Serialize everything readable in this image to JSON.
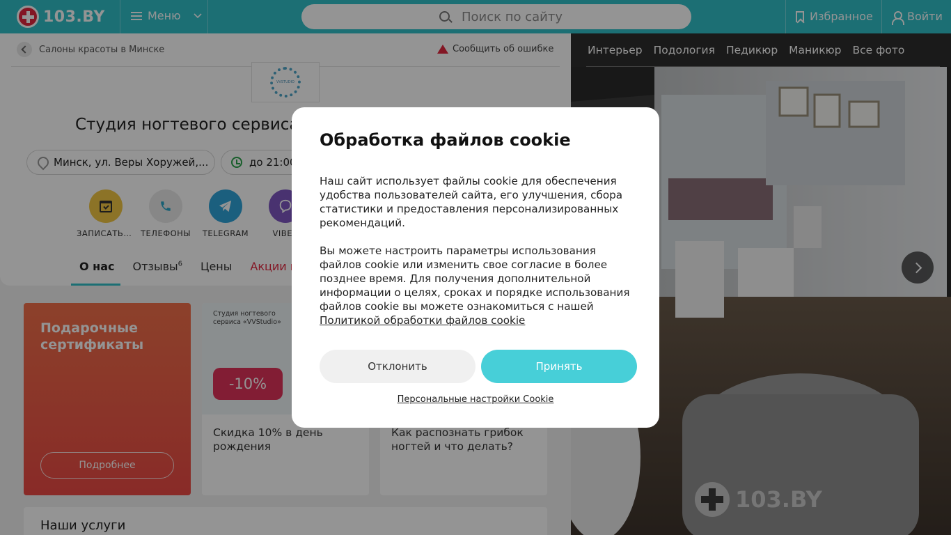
{
  "header": {
    "logo_text": "103.BY",
    "menu_label": "Меню",
    "search_placeholder": "Поиск по сайту",
    "favorites_label": "Избранное",
    "login_label": "Войти",
    "brand_color": "#31c0c9"
  },
  "breadcrumb": {
    "label": "Салоны красоты в Минске"
  },
  "report_error_label": "Сообщить об ошибке",
  "salon": {
    "logo_text": "VVSTUDIO",
    "title": "Студия ногтевого сервиса «VVStudio»",
    "address": "Минск, ул. Веры Хоружей,...",
    "hours": "до 21:00"
  },
  "actions": [
    {
      "label": "ЗАПИСАТЬСЯ",
      "icon": "calendar-icon",
      "color": "#f2c644"
    },
    {
      "label": "ТЕЛЕФОНЫ",
      "icon": "phone-icon",
      "color": "#e8e8e8"
    },
    {
      "label": "TELEGRAM",
      "icon": "telegram-icon",
      "color": "#30a4d9"
    },
    {
      "label": "VIBER",
      "icon": "viber-icon",
      "color": "#7e57c2"
    }
  ],
  "tabs": [
    {
      "label": "О нас",
      "badge": ""
    },
    {
      "label": "Отзывы",
      "badge": "6"
    },
    {
      "label": "Цены",
      "badge": ""
    },
    {
      "label": "Акции и новости",
      "badge": ""
    }
  ],
  "promos": {
    "gift_title": "Подарочные сертификаты",
    "gift_button": "Подробнее",
    "birthday_sub": "Студия ногтевого сервиса «VVStudio»",
    "birthday_badge": "-10%",
    "birthday_text": "Скидка 10% в день рождения",
    "fungus_text": "Как распознать грибок ногтей и что делать?"
  },
  "services_title": "Наши услуги",
  "gallery": {
    "tabs": [
      "Интерьер",
      "Подология",
      "Педикюр",
      "Маникюр",
      "Все фото"
    ],
    "watermark": "103.BY"
  },
  "cookie_dialog": {
    "title": "Обработка файлов cookie",
    "paragraph1": "Наш сайт использует файлы cookie для обеспечения удобства пользователей сайта, его улучшения, сбора статистики и предоставления персонализированных рекомендаций.",
    "paragraph2": "Вы можете настроить параметры использования файлов cookie или изменить свое согласие в более позднее время. Для получения дополнительной информации о целях, сроках и порядке использования файлов cookie вы можете ознакомиться с нашей",
    "policy_link": "Политикой обработки файлов cookie",
    "decline_label": "Отклонить",
    "accept_label": "Принять",
    "settings_link": "Персональные настройки Cookie",
    "accept_color": "#47cfd8"
  }
}
